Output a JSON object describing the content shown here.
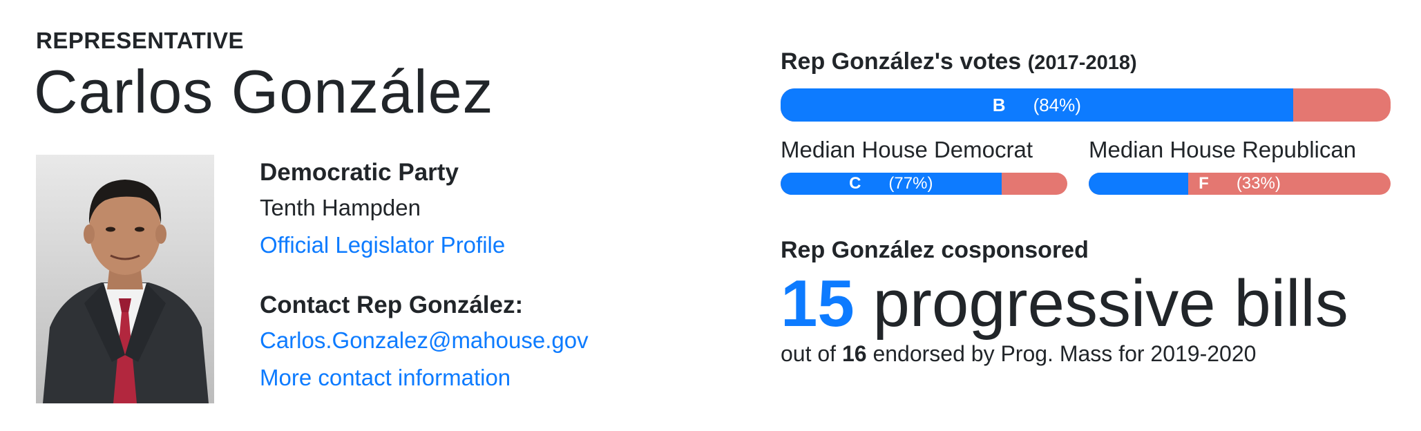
{
  "header": {
    "kicker": "REPRESENTATIVE",
    "name": "Carlos González"
  },
  "profile": {
    "party": "Democratic Party",
    "district": "Tenth Hampden",
    "profile_link": "Official Legislator Profile",
    "contact_heading": "Contact Rep González:",
    "email": "Carlos.Gonzalez@mahouse.gov",
    "more_contact": "More contact information"
  },
  "votes": {
    "heading": "Rep González's votes",
    "years": "(2017-2018)",
    "rep": {
      "grade": "B",
      "pct_label": "(84%)",
      "fraction": 0.84
    },
    "median_dem": {
      "label": "Median House Democrat",
      "grade": "C",
      "pct_label": "(77%)",
      "fraction": 0.77
    },
    "median_rep": {
      "label": "Median House Republican",
      "grade": "F",
      "pct_label": "(33%)",
      "fraction": 0.33
    }
  },
  "cosponsor": {
    "heading": "Rep González cosponsored",
    "count": "15",
    "count_suffix": "progressive bills",
    "sub_prefix": "out of",
    "sub_total": "16",
    "sub_suffix": "endorsed by Prog. Mass for 2019-2020"
  },
  "colors": {
    "accent_blue": "#0d7bff",
    "bar_red": "#e47771",
    "text": "#212529"
  },
  "icons": {
    "photo": "representative-portrait"
  }
}
